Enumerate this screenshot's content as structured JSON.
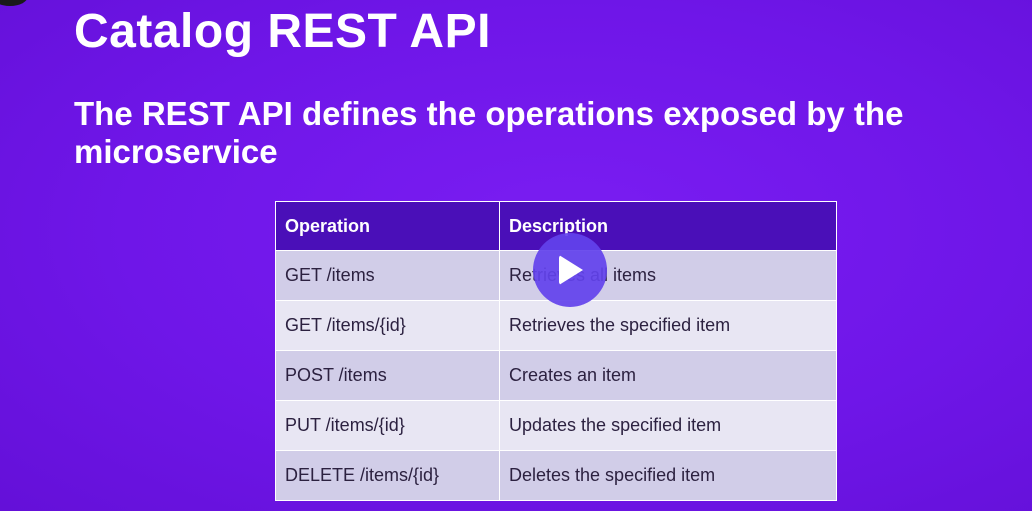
{
  "slide": {
    "title": "Catalog REST API",
    "subtitle": "The REST API defines the operations exposed by the microservice"
  },
  "table": {
    "headers": {
      "operation": "Operation",
      "description": "Description"
    },
    "rows": [
      {
        "operation": "GET /items",
        "description": "Retrieves all items"
      },
      {
        "operation": "GET /items/{id}",
        "description": "Retrieves the specified item"
      },
      {
        "operation": "POST /items",
        "description": "Creates an item"
      },
      {
        "operation": "PUT /items/{id}",
        "description": "Updates the specified item"
      },
      {
        "operation": "DELETE /items/{id}",
        "description": "Deletes the specified item"
      }
    ]
  },
  "colors": {
    "background": "#6f16e8",
    "header_row": "#4a0fb8",
    "row_odd": "#d1cde8",
    "row_even": "#e8e6f3",
    "play_button": "#6242ec"
  },
  "icons": {
    "play": "play-icon"
  }
}
